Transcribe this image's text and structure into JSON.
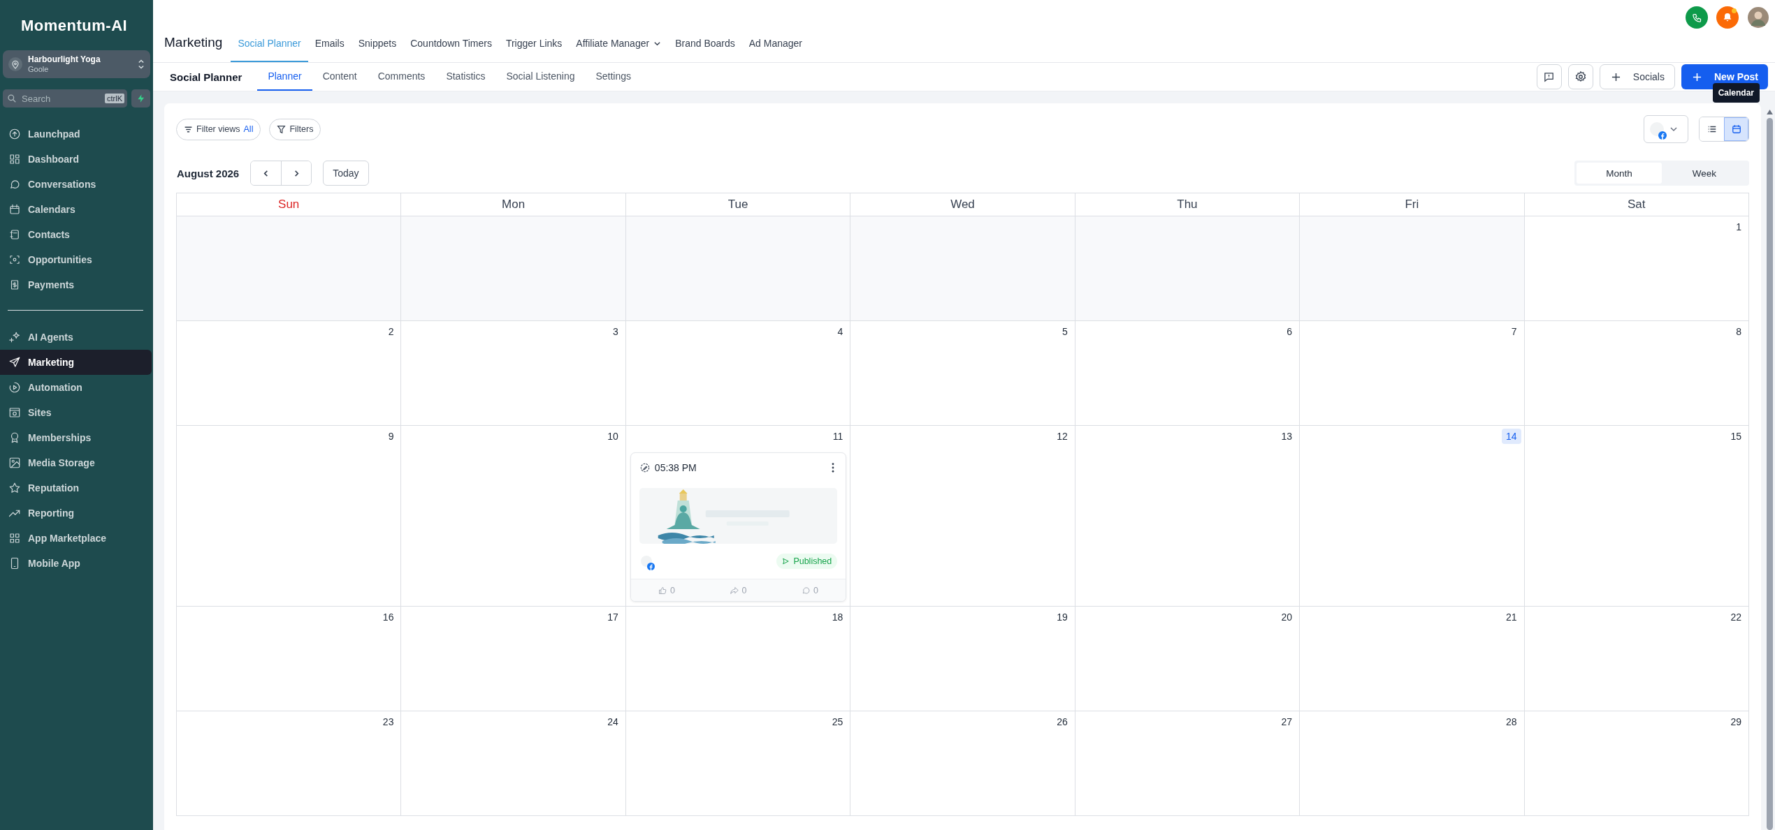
{
  "logo": "Momentum-AI",
  "account": {
    "name": "Harbourlight Yoga",
    "location": "Goole"
  },
  "search": {
    "placeholder": "Search",
    "shortcut": "ctrlK"
  },
  "sidebar": {
    "groups": [
      [
        {
          "label": "Launchpad",
          "selected": false
        },
        {
          "label": "Dashboard",
          "selected": false
        },
        {
          "label": "Conversations",
          "selected": false
        },
        {
          "label": "Calendars",
          "selected": false
        },
        {
          "label": "Contacts",
          "selected": false
        },
        {
          "label": "Opportunities",
          "selected": false
        },
        {
          "label": "Payments",
          "selected": false
        }
      ],
      [
        {
          "label": "AI Agents",
          "selected": false
        },
        {
          "label": "Marketing",
          "selected": true
        },
        {
          "label": "Automation",
          "selected": false
        },
        {
          "label": "Sites",
          "selected": false
        },
        {
          "label": "Memberships",
          "selected": false
        },
        {
          "label": "Media Storage",
          "selected": false
        },
        {
          "label": "Reputation",
          "selected": false
        },
        {
          "label": "Reporting",
          "selected": false
        },
        {
          "label": "App Marketplace",
          "selected": false
        },
        {
          "label": "Mobile App",
          "selected": false
        }
      ]
    ]
  },
  "section_title": "Marketing",
  "tabs": [
    {
      "label": "Social Planner",
      "selected": true,
      "has_menu": false
    },
    {
      "label": "Emails",
      "selected": false,
      "has_menu": false
    },
    {
      "label": "Snippets",
      "selected": false,
      "has_menu": false
    },
    {
      "label": "Countdown Timers",
      "selected": false,
      "has_menu": false
    },
    {
      "label": "Trigger Links",
      "selected": false,
      "has_menu": false
    },
    {
      "label": "Affiliate Manager",
      "selected": false,
      "has_menu": true
    },
    {
      "label": "Brand Boards",
      "selected": false,
      "has_menu": false
    },
    {
      "label": "Ad Manager",
      "selected": false,
      "has_menu": false
    }
  ],
  "notifications": {
    "unread": true
  },
  "subnav": {
    "title": "Social Planner",
    "tabs": [
      {
        "label": "Planner",
        "selected": true
      },
      {
        "label": "Content",
        "selected": false
      },
      {
        "label": "Comments",
        "selected": false
      },
      {
        "label": "Statistics",
        "selected": false
      },
      {
        "label": "Social Listening",
        "selected": false
      },
      {
        "label": "Settings",
        "selected": false
      }
    ]
  },
  "toolbar": {
    "socials_button": "Socials",
    "new_post_button": "New Post"
  },
  "tooltip": "Calendar",
  "filters": {
    "filter_views": {
      "label": "Filter views",
      "value": "All"
    },
    "filters_button": "Filters"
  },
  "view_toggle": [
    {
      "kind": "list",
      "selected": false
    },
    {
      "kind": "calendar",
      "selected": true
    }
  ],
  "calendar": {
    "month": "August 2026",
    "today_button": "Today",
    "ranges": [
      {
        "label": "Month",
        "selected": true
      },
      {
        "label": "Week",
        "selected": false
      }
    ],
    "weekdays": [
      {
        "label": "Sun",
        "accent": true
      },
      {
        "label": "Mon",
        "accent": false
      },
      {
        "label": "Tue",
        "accent": false
      },
      {
        "label": "Wed",
        "accent": false
      },
      {
        "label": "Thu",
        "accent": false
      },
      {
        "label": "Fri",
        "accent": false
      },
      {
        "label": "Sat",
        "accent": false
      }
    ],
    "weeks": [
      [
        {
          "kind": "blank"
        },
        {
          "kind": "blank"
        },
        {
          "kind": "blank"
        },
        {
          "kind": "blank"
        },
        {
          "kind": "blank"
        },
        {
          "kind": "blank"
        },
        {
          "kind": "day",
          "day": "1",
          "today": false
        }
      ],
      [
        {
          "kind": "day",
          "day": "2",
          "today": false
        },
        {
          "kind": "day",
          "day": "3",
          "today": false
        },
        {
          "kind": "day",
          "day": "4",
          "today": false
        },
        {
          "kind": "day",
          "day": "5",
          "today": false
        },
        {
          "kind": "day",
          "day": "6",
          "today": false
        },
        {
          "kind": "day",
          "day": "7",
          "today": false
        },
        {
          "kind": "day",
          "day": "8",
          "today": false
        }
      ],
      [
        {
          "kind": "day",
          "day": "9",
          "today": false
        },
        {
          "kind": "day",
          "day": "10",
          "today": false
        },
        {
          "kind": "day",
          "day": "11",
          "today": false,
          "posts": [
            {
              "time": "05:38 PM",
              "status": "Published",
              "likes": "0",
              "shares": "0",
              "comments": "0"
            }
          ]
        },
        {
          "kind": "day",
          "day": "12",
          "today": false
        },
        {
          "kind": "day",
          "day": "13",
          "today": false
        },
        {
          "kind": "day",
          "day": "14",
          "today": true
        },
        {
          "kind": "day",
          "day": "15",
          "today": false
        }
      ],
      [
        {
          "kind": "day",
          "day": "16",
          "today": false
        },
        {
          "kind": "day",
          "day": "17",
          "today": false
        },
        {
          "kind": "day",
          "day": "18",
          "today": false
        },
        {
          "kind": "day",
          "day": "19",
          "today": false
        },
        {
          "kind": "day",
          "day": "20",
          "today": false
        },
        {
          "kind": "day",
          "day": "21",
          "today": false
        },
        {
          "kind": "day",
          "day": "22",
          "today": false
        }
      ],
      [
        {
          "kind": "day",
          "day": "23",
          "today": false
        },
        {
          "kind": "day",
          "day": "24",
          "today": false
        },
        {
          "kind": "day",
          "day": "25",
          "today": false
        },
        {
          "kind": "day",
          "day": "26",
          "today": false
        },
        {
          "kind": "day",
          "day": "27",
          "today": false
        },
        {
          "kind": "day",
          "day": "28",
          "today": false
        },
        {
          "kind": "day",
          "day": "29",
          "today": false
        }
      ]
    ]
  }
}
